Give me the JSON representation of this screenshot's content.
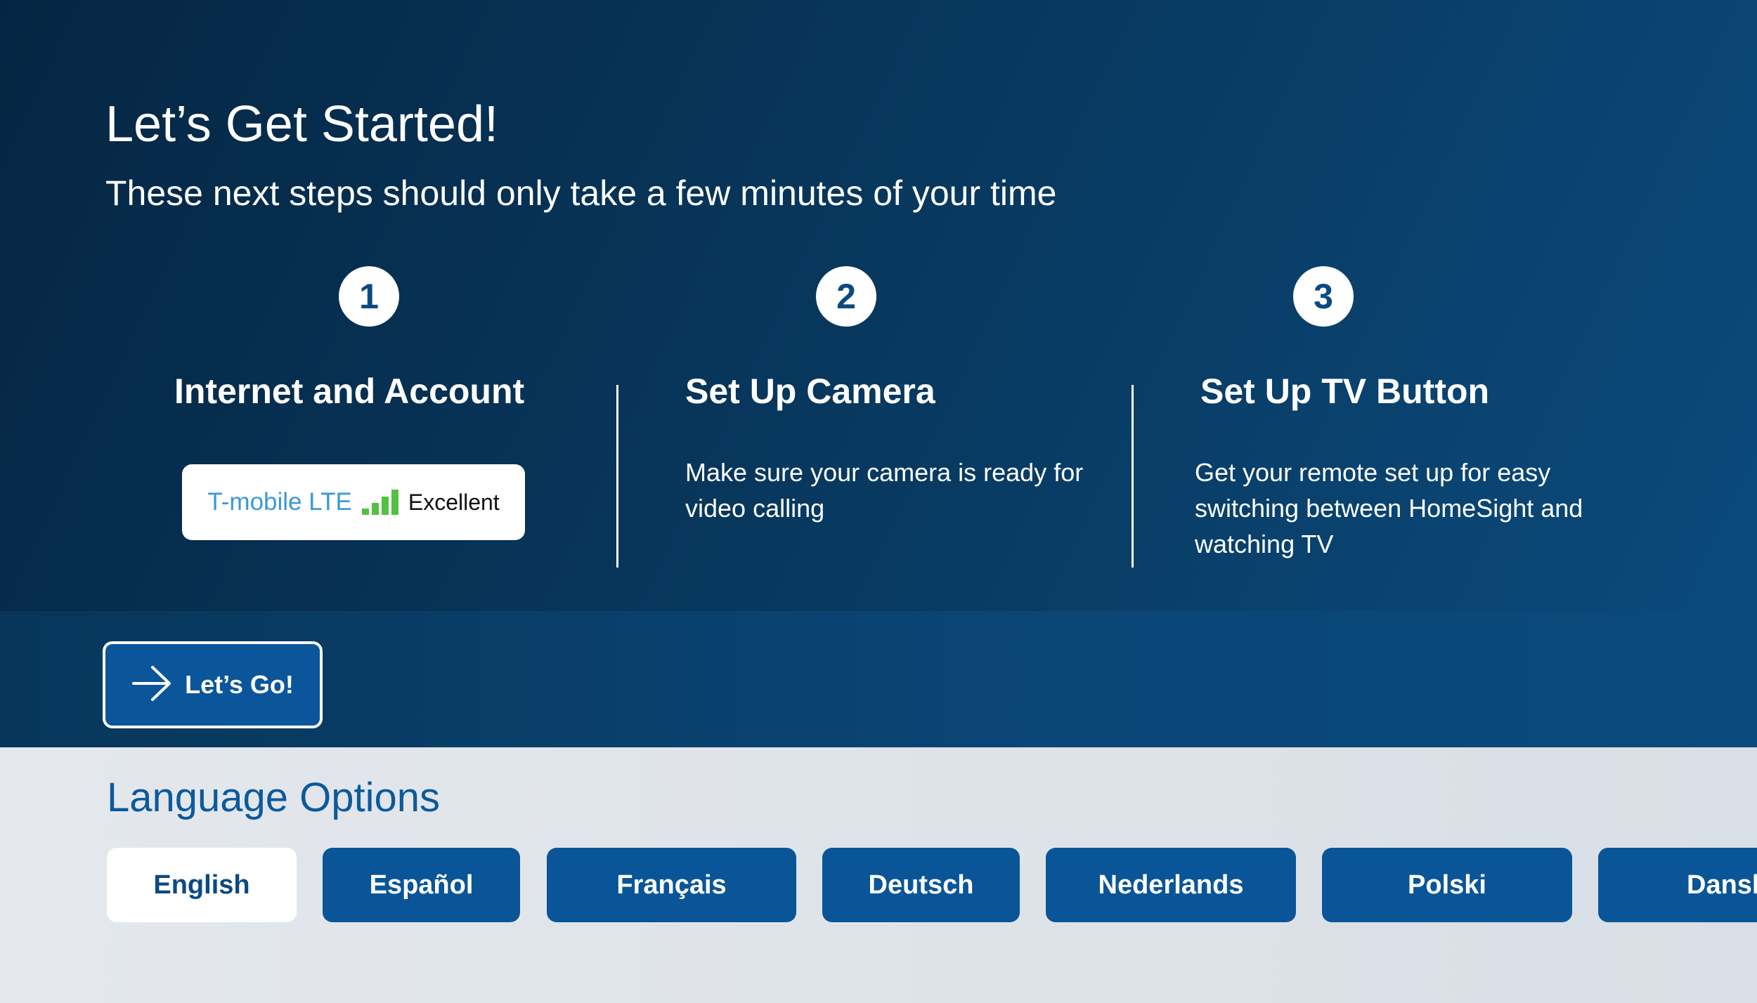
{
  "header": {
    "title": "Let’s Get Started!",
    "subtitle": "These next steps should only take a few minutes of your time"
  },
  "steps": [
    {
      "number": "1",
      "title": "Internet and Account",
      "network": {
        "name": "T-mobile LTE",
        "quality": "Excellent",
        "signal_icon": "signal-bars-icon"
      }
    },
    {
      "number": "2",
      "title": "Set Up Camera",
      "description": "Make sure your camera is ready for video calling"
    },
    {
      "number": "3",
      "title": "Set Up TV Button",
      "description": "Get your remote set up for easy switching between HomeSight and watching TV"
    }
  ],
  "action": {
    "go_label": "Let’s Go!",
    "icon": "arrow-right-icon"
  },
  "languages": {
    "heading": "Language Options",
    "selected": "English",
    "options": [
      "English",
      "Español",
      "Français",
      "Deutsch",
      "Nederlands",
      "Polski",
      "Dansk"
    ]
  },
  "colors": {
    "hero_bg": "#052643",
    "accent_blue": "#0a5597",
    "signal_green": "#54c042",
    "network_blue": "#3a98d8",
    "lang_bg": "#e0e5eb"
  }
}
